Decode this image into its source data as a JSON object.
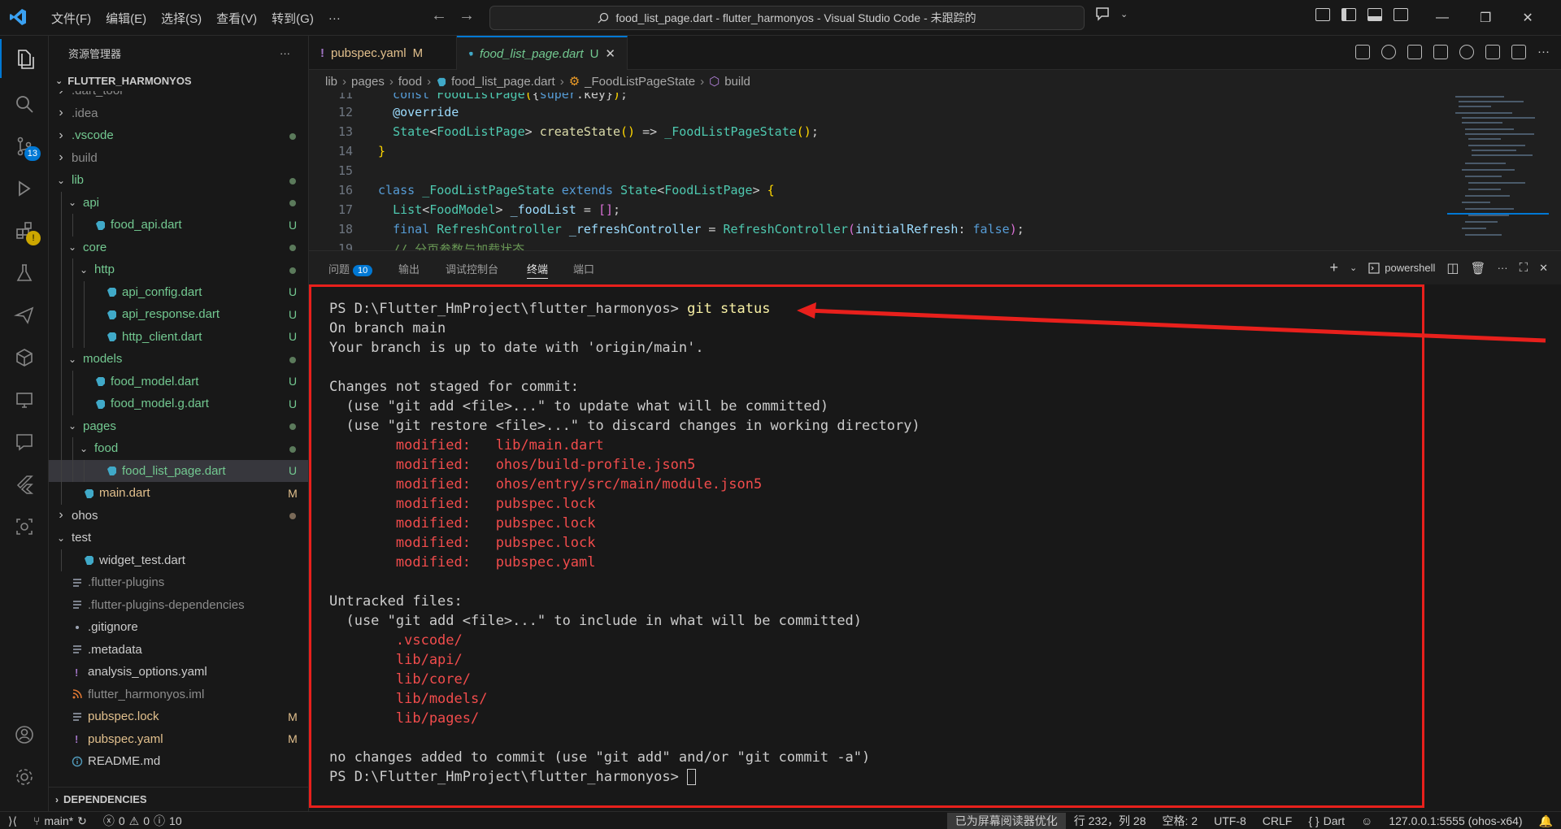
{
  "window": {
    "menus": [
      "文件(F)",
      "编辑(E)",
      "选择(S)",
      "查看(V)",
      "转到(G)",
      "···"
    ],
    "command_center": "food_list_page.dart - flutter_harmonyos - Visual Studio Code - 未跟踪的"
  },
  "activity": {
    "scm_badge": "13"
  },
  "sidebar": {
    "title": "资源管理器",
    "more": "···",
    "project": "FLUTTER_HARMONYOS",
    "tree": [
      {
        "name": ".dart_tool",
        "depth": 0,
        "kind": "folder",
        "status": ""
      },
      {
        "name": ".idea",
        "depth": 0,
        "kind": "folder",
        "status": ""
      },
      {
        "name": ".vscode",
        "depth": 0,
        "kind": "folder",
        "status": "dot"
      },
      {
        "name": "build",
        "depth": 0,
        "kind": "folder",
        "status": ""
      },
      {
        "name": "lib",
        "depth": 0,
        "kind": "folder-open",
        "status": "dot"
      },
      {
        "name": "api",
        "depth": 1,
        "kind": "folder-open",
        "status": "dot"
      },
      {
        "name": "food_api.dart",
        "depth": 2,
        "kind": "dart",
        "status": "U"
      },
      {
        "name": "core",
        "depth": 1,
        "kind": "folder-open",
        "status": "dot"
      },
      {
        "name": "http",
        "depth": 2,
        "kind": "folder-open",
        "status": "dot"
      },
      {
        "name": "api_config.dart",
        "depth": 3,
        "kind": "dart",
        "status": "U"
      },
      {
        "name": "api_response.dart",
        "depth": 3,
        "kind": "dart",
        "status": "U"
      },
      {
        "name": "http_client.dart",
        "depth": 3,
        "kind": "dart",
        "status": "U"
      },
      {
        "name": "models",
        "depth": 1,
        "kind": "folder-open",
        "status": "dot"
      },
      {
        "name": "food_model.dart",
        "depth": 2,
        "kind": "dart",
        "status": "U"
      },
      {
        "name": "food_model.g.dart",
        "depth": 2,
        "kind": "dart",
        "status": "U"
      },
      {
        "name": "pages",
        "depth": 1,
        "kind": "folder-open",
        "status": "dot"
      },
      {
        "name": "food",
        "depth": 2,
        "kind": "folder-open",
        "status": "dot"
      },
      {
        "name": "food_list_page.dart",
        "depth": 3,
        "kind": "dart",
        "status": "U"
      },
      {
        "name": "main.dart",
        "depth": 1,
        "kind": "dart",
        "status": "M"
      },
      {
        "name": "ohos",
        "depth": 0,
        "kind": "folder",
        "status": "dot2"
      },
      {
        "name": "test",
        "depth": 0,
        "kind": "folder-open",
        "status": ""
      },
      {
        "name": "widget_test.dart",
        "depth": 1,
        "kind": "dart",
        "status": ""
      },
      {
        "name": ".flutter-plugins",
        "depth": 0,
        "kind": "lines",
        "status": ""
      },
      {
        "name": ".flutter-plugins-dependencies",
        "depth": 0,
        "kind": "lines",
        "status": ""
      },
      {
        "name": ".gitignore",
        "depth": 0,
        "kind": "git",
        "status": ""
      },
      {
        "name": ".metadata",
        "depth": 0,
        "kind": "lines",
        "status": ""
      },
      {
        "name": "analysis_options.yaml",
        "depth": 0,
        "kind": "yaml",
        "status": ""
      },
      {
        "name": "flutter_harmonyos.iml",
        "depth": 0,
        "kind": "rss",
        "status": ""
      },
      {
        "name": "pubspec.lock",
        "depth": 0,
        "kind": "lines",
        "status": "M"
      },
      {
        "name": "pubspec.yaml",
        "depth": 0,
        "kind": "yaml",
        "status": "M"
      },
      {
        "name": "README.md",
        "depth": 0,
        "kind": "info",
        "status": ""
      }
    ],
    "dependencies": "DEPENDENCIES"
  },
  "tabs": [
    {
      "label": "pubspec.yaml",
      "status": "M",
      "icon": "!"
    },
    {
      "label": "food_list_page.dart",
      "status": "U",
      "icon": "dart"
    }
  ],
  "breadcrumb": [
    "lib",
    "pages",
    "food",
    "food_list_page.dart",
    "_FoodListPageState",
    "build"
  ],
  "code": {
    "line_numbers": [
      "11",
      "12",
      "13",
      "14",
      "15",
      "16",
      "17",
      "18",
      "19"
    ]
  },
  "panel": {
    "tabs": [
      "问题",
      "输出",
      "调试控制台",
      "终端",
      "端口"
    ],
    "problems_badge": "10",
    "shell": "powershell"
  },
  "terminal": {
    "prompt": "PS D:\\Flutter_HmProject\\flutter_harmonyos> ",
    "command": "git status",
    "lines": [
      {
        "text": "On branch main",
        "color": "normal"
      },
      {
        "text": "Your branch is up to date with 'origin/main'.",
        "color": "normal"
      },
      {
        "text": "",
        "color": "normal"
      },
      {
        "text": "Changes not staged for commit:",
        "color": "normal"
      },
      {
        "text": "  (use \"git add <file>...\" to update what will be committed)",
        "color": "normal"
      },
      {
        "text": "  (use \"git restore <file>...\" to discard changes in working directory)",
        "color": "normal"
      },
      {
        "text": "        modified:   lib/main.dart",
        "color": "red"
      },
      {
        "text": "        modified:   ohos/build-profile.json5",
        "color": "red"
      },
      {
        "text": "        modified:   ohos/entry/src/main/module.json5",
        "color": "red"
      },
      {
        "text": "        modified:   pubspec.lock",
        "color": "red"
      },
      {
        "text": "        modified:   pubspec.lock",
        "color": "red"
      },
      {
        "text": "        modified:   pubspec.lock",
        "color": "red"
      },
      {
        "text": "        modified:   pubspec.yaml",
        "color": "red"
      },
      {
        "text": "",
        "color": "normal"
      },
      {
        "text": "Untracked files:",
        "color": "normal"
      },
      {
        "text": "  (use \"git add <file>...\" to include in what will be committed)",
        "color": "normal"
      },
      {
        "text": "        .vscode/",
        "color": "red"
      },
      {
        "text": "        lib/api/",
        "color": "red"
      },
      {
        "text": "        lib/core/",
        "color": "red"
      },
      {
        "text": "        lib/models/",
        "color": "red"
      },
      {
        "text": "        lib/pages/",
        "color": "red"
      },
      {
        "text": "",
        "color": "normal"
      },
      {
        "text": "no changes added to commit (use \"git add\" and/or \"git commit -a\")",
        "color": "normal"
      }
    ]
  },
  "statusbar": {
    "branch": "main*",
    "errors": "0",
    "warnings": "0",
    "info": "10",
    "screen_reader": "已为屏幕阅读器优化",
    "position": "行 232，列 28",
    "spaces": "空格: 2",
    "encoding": "UTF-8",
    "eol": "CRLF",
    "language": "Dart",
    "device": "127.0.0.1:5555 (ohos-x64)"
  },
  "colors": {
    "accent": "#0078d4",
    "annotation_red": "#e8201c",
    "terminal_red": "#f14c4c",
    "untracked_green": "#73c991",
    "modified_yellow": "#e2c08d"
  }
}
